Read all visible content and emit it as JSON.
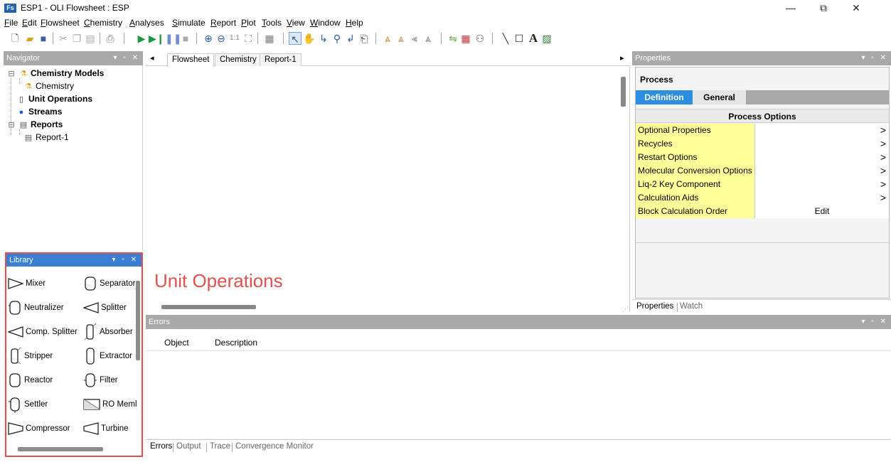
{
  "window": {
    "title": "ESP1 - OLI Flowsheet : ESP",
    "app_icon_text": "Fs",
    "controls": {
      "minimize": "—",
      "restore": "⧉",
      "close": "✕"
    }
  },
  "menu": [
    {
      "label": "File",
      "accel": "F",
      "rest": "ile"
    },
    {
      "label": "Edit",
      "accel": "E",
      "rest": "dit"
    },
    {
      "label": "Flowsheet",
      "accel": "F",
      "rest": "lowsheet"
    },
    {
      "label": "Chemistry",
      "accel": "C",
      "rest": "hemistry"
    },
    {
      "label": "Analyses",
      "accel": "A",
      "rest": "nalyses"
    },
    {
      "label": "Simulate",
      "accel": "S",
      "rest": "imulate"
    },
    {
      "label": "Report",
      "accel": "R",
      "rest": "eport"
    },
    {
      "label": "Plot",
      "accel": "P",
      "rest": "lot"
    },
    {
      "label": "Tools",
      "accel": "T",
      "rest": "ools"
    },
    {
      "label": "View",
      "accel": "V",
      "rest": "iew"
    },
    {
      "label": "Window",
      "accel": "W",
      "rest": "indow"
    },
    {
      "label": "Help",
      "accel": "H",
      "rest": "elp"
    }
  ],
  "navigator": {
    "title": "Navigator",
    "header_controls": "▾ ▫ ✕",
    "tree": [
      {
        "label": "Chemistry Models",
        "level": 0,
        "bold": true,
        "icon": "flask-icon",
        "expander": "⊟"
      },
      {
        "label": "Chemistry",
        "level": 1,
        "bold": false,
        "icon": "flask-icon"
      },
      {
        "label": "Unit Operations",
        "level": 0,
        "bold": true,
        "icon": "vessel-icon"
      },
      {
        "label": "Streams",
        "level": 0,
        "bold": true,
        "icon": "drop-icon"
      },
      {
        "label": "Reports",
        "level": 0,
        "bold": true,
        "icon": "report-icon",
        "expander": "⊟"
      },
      {
        "label": "Report-1",
        "level": 1,
        "bold": false,
        "icon": "report-icon"
      }
    ]
  },
  "library": {
    "title": "Library",
    "header_controls": "▾ ▫ ✕",
    "items": [
      {
        "label": "Mixer",
        "icon": "mixer-icon"
      },
      {
        "label": "Separator",
        "icon": "separator-icon"
      },
      {
        "label": "Neutralizer",
        "icon": "neutralizer-icon"
      },
      {
        "label": "Splitter",
        "icon": "splitter-icon"
      },
      {
        "label": "Comp. Splitter",
        "icon": "comp-splitter-icon"
      },
      {
        "label": "Absorber",
        "icon": "absorber-icon"
      },
      {
        "label": "Stripper",
        "icon": "stripper-icon"
      },
      {
        "label": "Extractor",
        "icon": "extractor-icon"
      },
      {
        "label": "Reactor",
        "icon": "reactor-icon"
      },
      {
        "label": "Filter",
        "icon": "filter-icon"
      },
      {
        "label": "Settler",
        "icon": "settler-icon"
      },
      {
        "label": "RO Meml",
        "icon": "ro-membrane-icon"
      },
      {
        "label": "Compressor",
        "icon": "compressor-icon"
      },
      {
        "label": "Turbine",
        "icon": "turbine-icon"
      }
    ]
  },
  "doc_tabs": {
    "scroll_left": "◂",
    "scroll_right": "▸",
    "tabs": [
      {
        "label": "Flowsheet",
        "active": true
      },
      {
        "label": "Chemistry",
        "active": false
      },
      {
        "label": "Report-1",
        "active": false
      }
    ]
  },
  "annotation": "Unit Operations",
  "errors": {
    "title": "Errors",
    "header_controls": "▾ ▫ ✕",
    "columns": [
      "Object",
      "Description"
    ],
    "bottom_tabs": [
      "Errors",
      "Output",
      "Trace",
      "Convergence Monitor"
    ]
  },
  "properties": {
    "title": "Properties",
    "header_controls": "▾ ▫ ✕",
    "section_title": "Process",
    "tabs": [
      "Definition",
      "General"
    ],
    "group_title": "Process Options",
    "rows": [
      {
        "label": "Optional Properties",
        "value": "",
        "chevron": ">"
      },
      {
        "label": "Recycles",
        "value": "",
        "chevron": ">"
      },
      {
        "label": "Restart Options",
        "value": "",
        "chevron": ">"
      },
      {
        "label": "Molecular Conversion Options",
        "value": "",
        "chevron": ">"
      },
      {
        "label": "Liq-2 Key Component",
        "value": "",
        "chevron": ">"
      },
      {
        "label": "Calculation Aids",
        "value": "",
        "chevron": ">"
      },
      {
        "label": "Block Calculation Order",
        "value": "Edit",
        "chevron": ""
      }
    ],
    "bottom_tabs": [
      "Properties",
      "Watch"
    ]
  },
  "colors": {
    "panel_header_gray": "#a9a9a9",
    "library_header_blue": "#3b7fd4",
    "tab_active_blue": "#2c8ee0",
    "highlight_red": "#e35050",
    "property_label_yellow": "#ffff99"
  }
}
